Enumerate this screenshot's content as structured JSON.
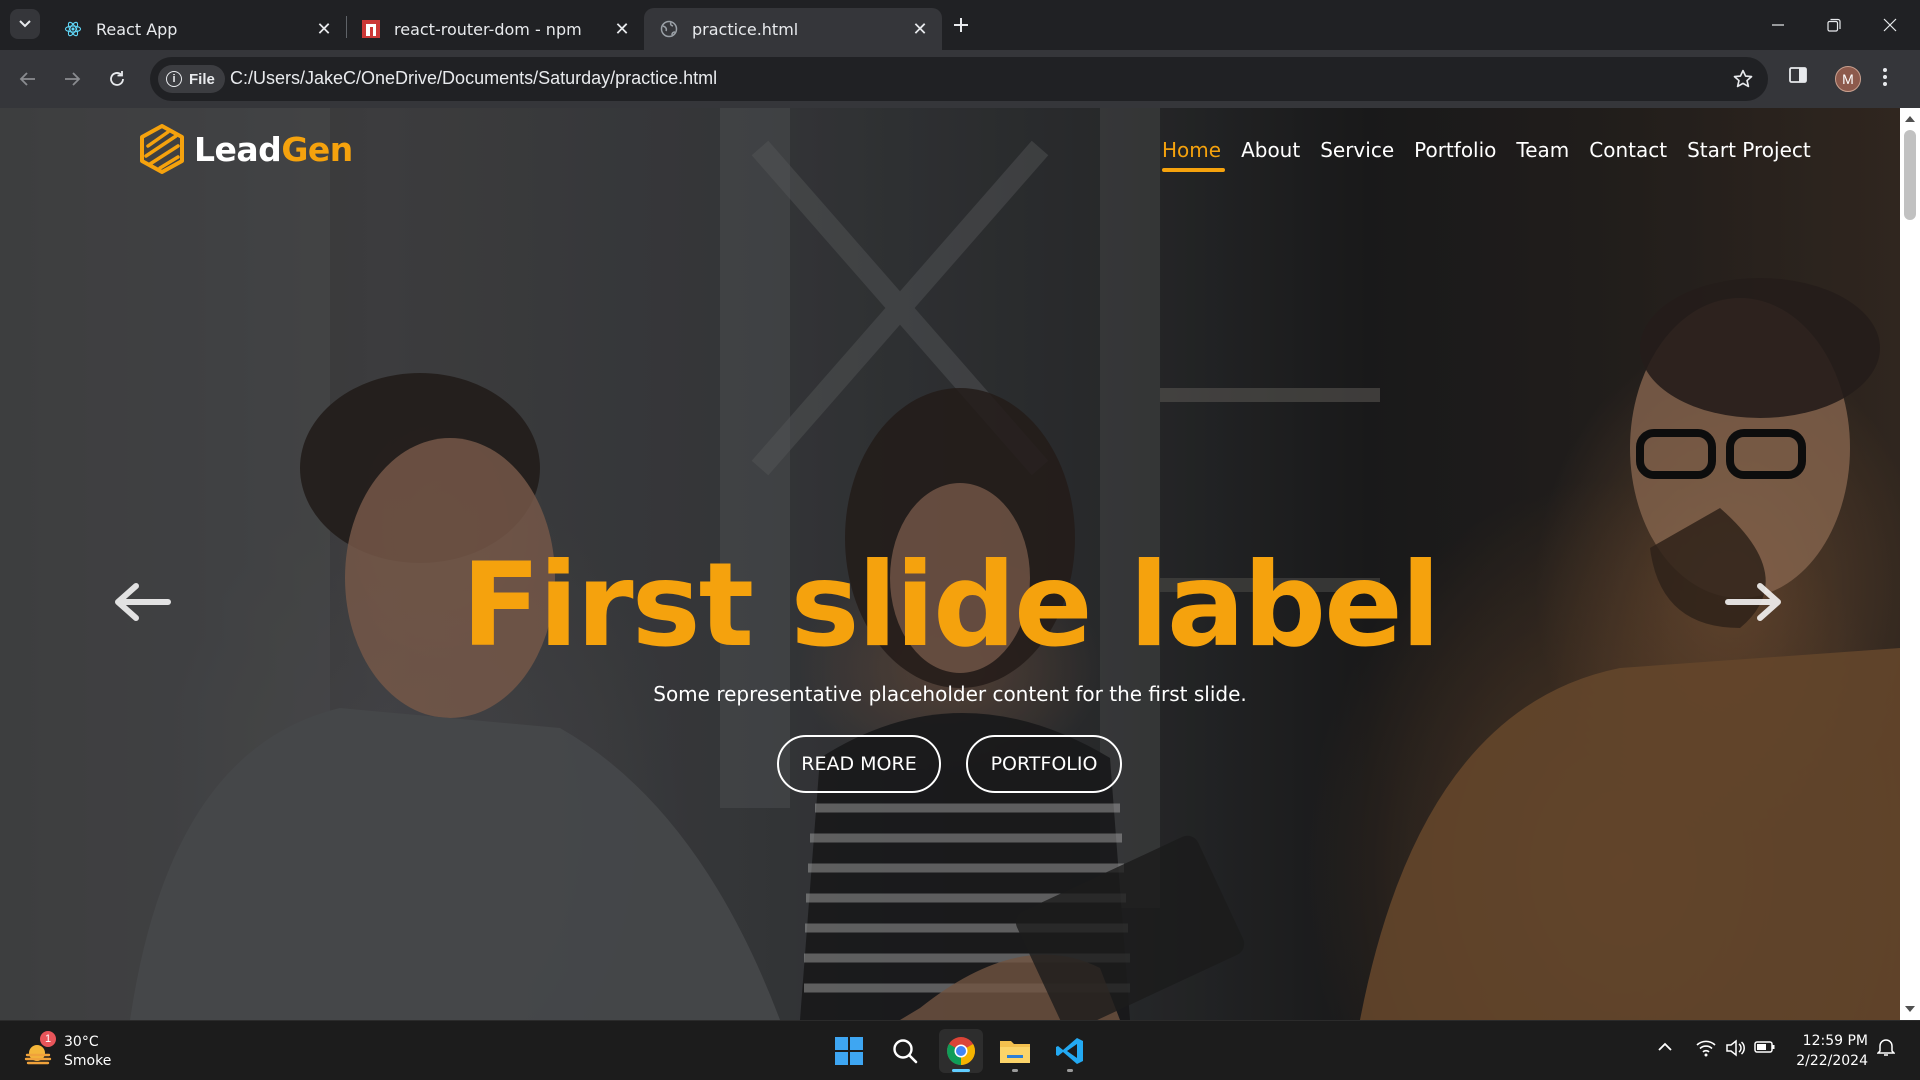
{
  "browser": {
    "tabs": [
      {
        "title": "React App",
        "icon": "react-icon",
        "active": false
      },
      {
        "title": "react-router-dom - npm",
        "icon": "npm-icon",
        "active": false
      },
      {
        "title": "practice.html",
        "icon": "globe-icon",
        "active": true
      }
    ],
    "omnibox": {
      "chip_label": "File",
      "url": "C:/Users/JakeC/OneDrive/Documents/Saturday/practice.html"
    },
    "profile_initial": "M"
  },
  "site": {
    "brand": {
      "part1": "Lead",
      "part2": "Gen"
    },
    "nav": [
      {
        "label": "Home",
        "active": true
      },
      {
        "label": "About",
        "active": false
      },
      {
        "label": "Service",
        "active": false
      },
      {
        "label": "Portfolio",
        "active": false
      },
      {
        "label": "Team",
        "active": false
      },
      {
        "label": "Contact",
        "active": false
      },
      {
        "label": "Start Project",
        "active": false
      }
    ],
    "hero": {
      "title": "First slide label",
      "subtitle": "Some representative placeholder content for the first slide.",
      "primary_button": "READ MORE",
      "secondary_button": "PORTFOLIO"
    },
    "colors": {
      "accent": "#f5a20d"
    }
  },
  "taskbar": {
    "weather": {
      "temp": "30°C",
      "condition": "Smoke",
      "badge": "1"
    },
    "clock": {
      "time": "12:59 PM",
      "date": "2/22/2024"
    },
    "apps": [
      "start-icon",
      "search-icon",
      "chrome-icon",
      "file-explorer-icon",
      "vscode-icon"
    ]
  }
}
